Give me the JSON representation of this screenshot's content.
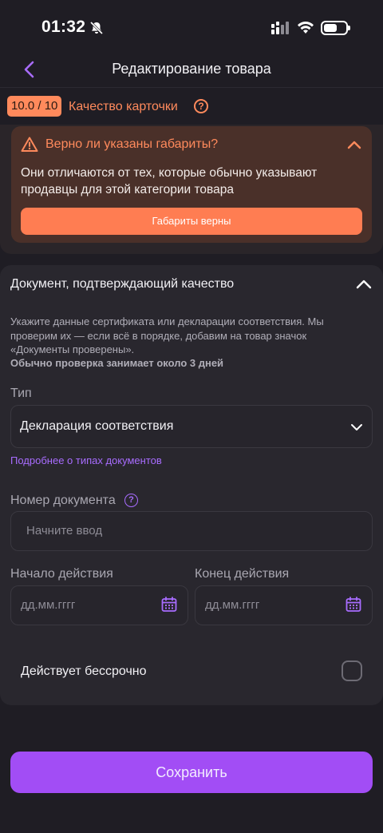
{
  "status_bar": {
    "time": "01:32",
    "icons": [
      "bell-muted-icon",
      "signal-icon",
      "wifi-icon",
      "battery-icon"
    ]
  },
  "header": {
    "title": "Редактирование товара",
    "back_icon": "chevron-left-icon"
  },
  "quality": {
    "score": "10.0 / 10",
    "label": "Качество карточки",
    "help_glyph": "?"
  },
  "warning": {
    "title": "Верно ли указаны габариты?",
    "text": "Они отличаются от тех, которые обычно указывают продавцы для этой категории товара",
    "button_label": "Габариты верны"
  },
  "document": {
    "title": "Документ, подтверждающий качество",
    "description": "Укажите данные сертификата или декларации соответствия. Мы проверим их — если всё в порядке, добавим на товар значок «Документы проверены».",
    "description_bold": "Обычно проверка занимает около 3 дней",
    "type_label": "Тип",
    "type_value": "Декларация соответствия",
    "types_link": "Подробнее о типах документов",
    "number_label": "Номер документа",
    "number_help_glyph": "?",
    "number_placeholder": "Начните ввод",
    "start_label": "Начало действия",
    "start_placeholder": "дд.мм.гггг",
    "end_label": "Конец действия",
    "end_placeholder": "дд.мм.гггг",
    "perpetual_label": "Действует бессрочно",
    "perpetual_checked": false
  },
  "footer": {
    "save_label": "Сохранить"
  },
  "colors": {
    "accent_purple": "#a24df5",
    "warning_orange": "#ff8a5c",
    "background": "#1f1d24"
  }
}
